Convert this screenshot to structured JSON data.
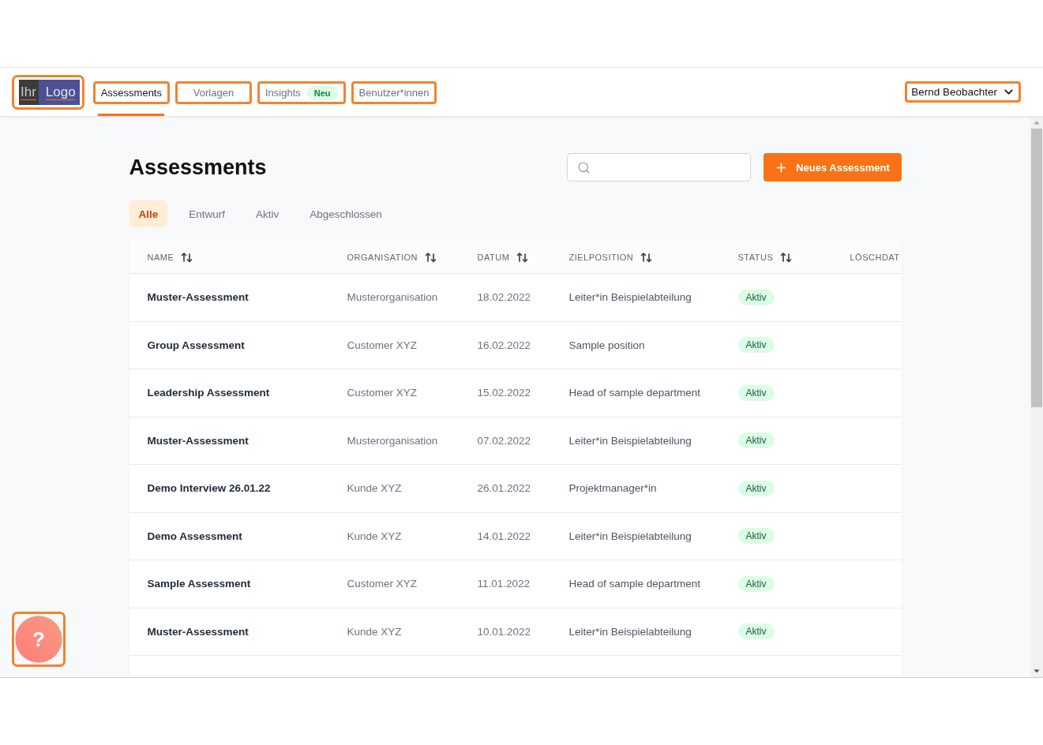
{
  "logo": {
    "highlighted": true,
    "words": [
      "Ihr",
      "Logo"
    ]
  },
  "nav": [
    {
      "label": "Assessments",
      "selected": true,
      "highlighted": true
    },
    {
      "label": "Vorlagen",
      "selected": false,
      "highlighted": true
    },
    {
      "label": "Insights",
      "badge": "Neu",
      "selected": false,
      "highlighted": true
    },
    {
      "label": "Benutzer*innen",
      "selected": false,
      "highlighted": true
    }
  ],
  "user_menu": {
    "name": "Bernd Beobachter",
    "highlighted": true
  },
  "page": {
    "title": "Assessments",
    "new_button": "Neues Assessment"
  },
  "filters": [
    {
      "label": "Alle",
      "selected": true
    },
    {
      "label": "Entwurf",
      "selected": false
    },
    {
      "label": "Aktiv",
      "selected": false
    },
    {
      "label": "Abgeschlossen",
      "selected": false
    }
  ],
  "table": {
    "columns": [
      {
        "label": "NAME",
        "sortable": true
      },
      {
        "label": "ORGANISATION",
        "sortable": true
      },
      {
        "label": "DATUM",
        "sortable": true
      },
      {
        "label": "ZIELPOSITION",
        "sortable": true
      },
      {
        "label": "STATUS",
        "sortable": true
      },
      {
        "label": "LÖSCHDAT",
        "sortable": false
      }
    ],
    "rows": [
      {
        "name": "Muster-Assessment",
        "organisation": "Musterorganisation",
        "date": "18.02.2022",
        "target_position": "Leiter*in Beispielabteilung",
        "status": {
          "label": "Aktiv",
          "color": "#dcfce7"
        }
      },
      {
        "name": "Group Assessment",
        "organisation": "Customer XYZ",
        "date": "16.02.2022",
        "target_position": "Sample position",
        "status": {
          "label": "Aktiv",
          "color": "#dcfce7"
        }
      },
      {
        "name": "Leadership Assessment",
        "organisation": "Customer XYZ",
        "date": "15.02.2022",
        "target_position": "Head of sample department",
        "status": {
          "label": "Aktiv",
          "color": "#dcfce7"
        }
      },
      {
        "name": "Muster-Assessment",
        "organisation": "Musterorganisation",
        "date": "07.02.2022",
        "target_position": "Leiter*in Beispielabteilung",
        "status": {
          "label": "Aktiv",
          "color": "#dcfce7"
        }
      },
      {
        "name": "Demo Interview 26.01.22",
        "organisation": "Kunde XYZ",
        "date": "26.01.2022",
        "target_position": "Projektmanager*in",
        "status": {
          "label": "Aktiv",
          "color": "#dcfce7"
        }
      },
      {
        "name": "Demo Assessment",
        "organisation": "Kunde XYZ",
        "date": "14.01.2022",
        "target_position": "Leiter*in Beispielabteilung",
        "status": {
          "label": "Aktiv",
          "color": "#dcfce7"
        }
      },
      {
        "name": "Sample Assessment",
        "organisation": "Customer XYZ",
        "date": "11.01.2022",
        "target_position": "Head of sample department",
        "status": {
          "label": "Aktiv",
          "color": "#dcfce7"
        }
      },
      {
        "name": "Muster-Assessment",
        "organisation": "Kunde XYZ",
        "date": "10.01.2022",
        "target_position": "Leiter*in Beispielabteilung",
        "status": {
          "label": "Aktiv",
          "color": "#dcfce7"
        }
      }
    ]
  },
  "help_button": {
    "label": "?",
    "highlighted": true
  }
}
